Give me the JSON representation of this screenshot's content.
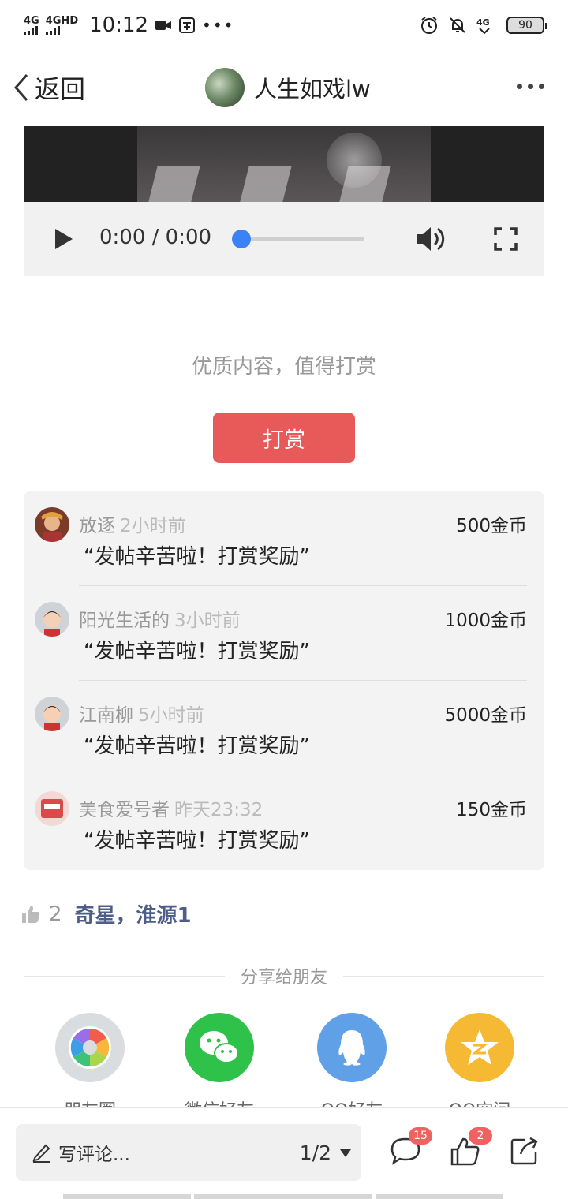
{
  "status": {
    "net1": "4G",
    "net2": "4GHD",
    "time": "10:12",
    "battery": "90"
  },
  "nav": {
    "back_label": "返回",
    "title": "人生如戏lw"
  },
  "player": {
    "time": "0:00 / 0:00",
    "progress": 0
  },
  "reward": {
    "tip": "优质内容，值得打赏",
    "button": "打赏",
    "items": [
      {
        "name": "放逐",
        "time": "2小时前",
        "coins": "500金币",
        "message": "“发帖辛苦啦！打赏奖励”"
      },
      {
        "name": "阳光生活的",
        "time": "3小时前",
        "coins": "1000金币",
        "message": "“发帖辛苦啦！打赏奖励”"
      },
      {
        "name": "江南柳",
        "time": "5小时前",
        "coins": "5000金币",
        "message": "“发帖辛苦啦！打赏奖励”"
      },
      {
        "name": "美食爱号者",
        "time": "昨天23:32",
        "coins": "150金币",
        "message": "“发帖辛苦啦！打赏奖励”"
      }
    ]
  },
  "likes": {
    "count": "2",
    "names": "奇星，淮源1"
  },
  "share": {
    "header": "分享给朋友",
    "items": [
      {
        "label": "朋友圈",
        "icon": "moments-icon",
        "color": "#d9dde0"
      },
      {
        "label": "微信好友",
        "icon": "wechat-icon",
        "color": "#2fc24a"
      },
      {
        "label": "QQ好友",
        "icon": "qq-icon",
        "color": "#5fa0e6"
      },
      {
        "label": "QQ空间",
        "icon": "qzone-icon",
        "color": "#f5b934"
      }
    ]
  },
  "bottom": {
    "comment_placeholder": "写评论...",
    "page": "1/2",
    "comment_badge": "15",
    "like_badge": "2"
  }
}
